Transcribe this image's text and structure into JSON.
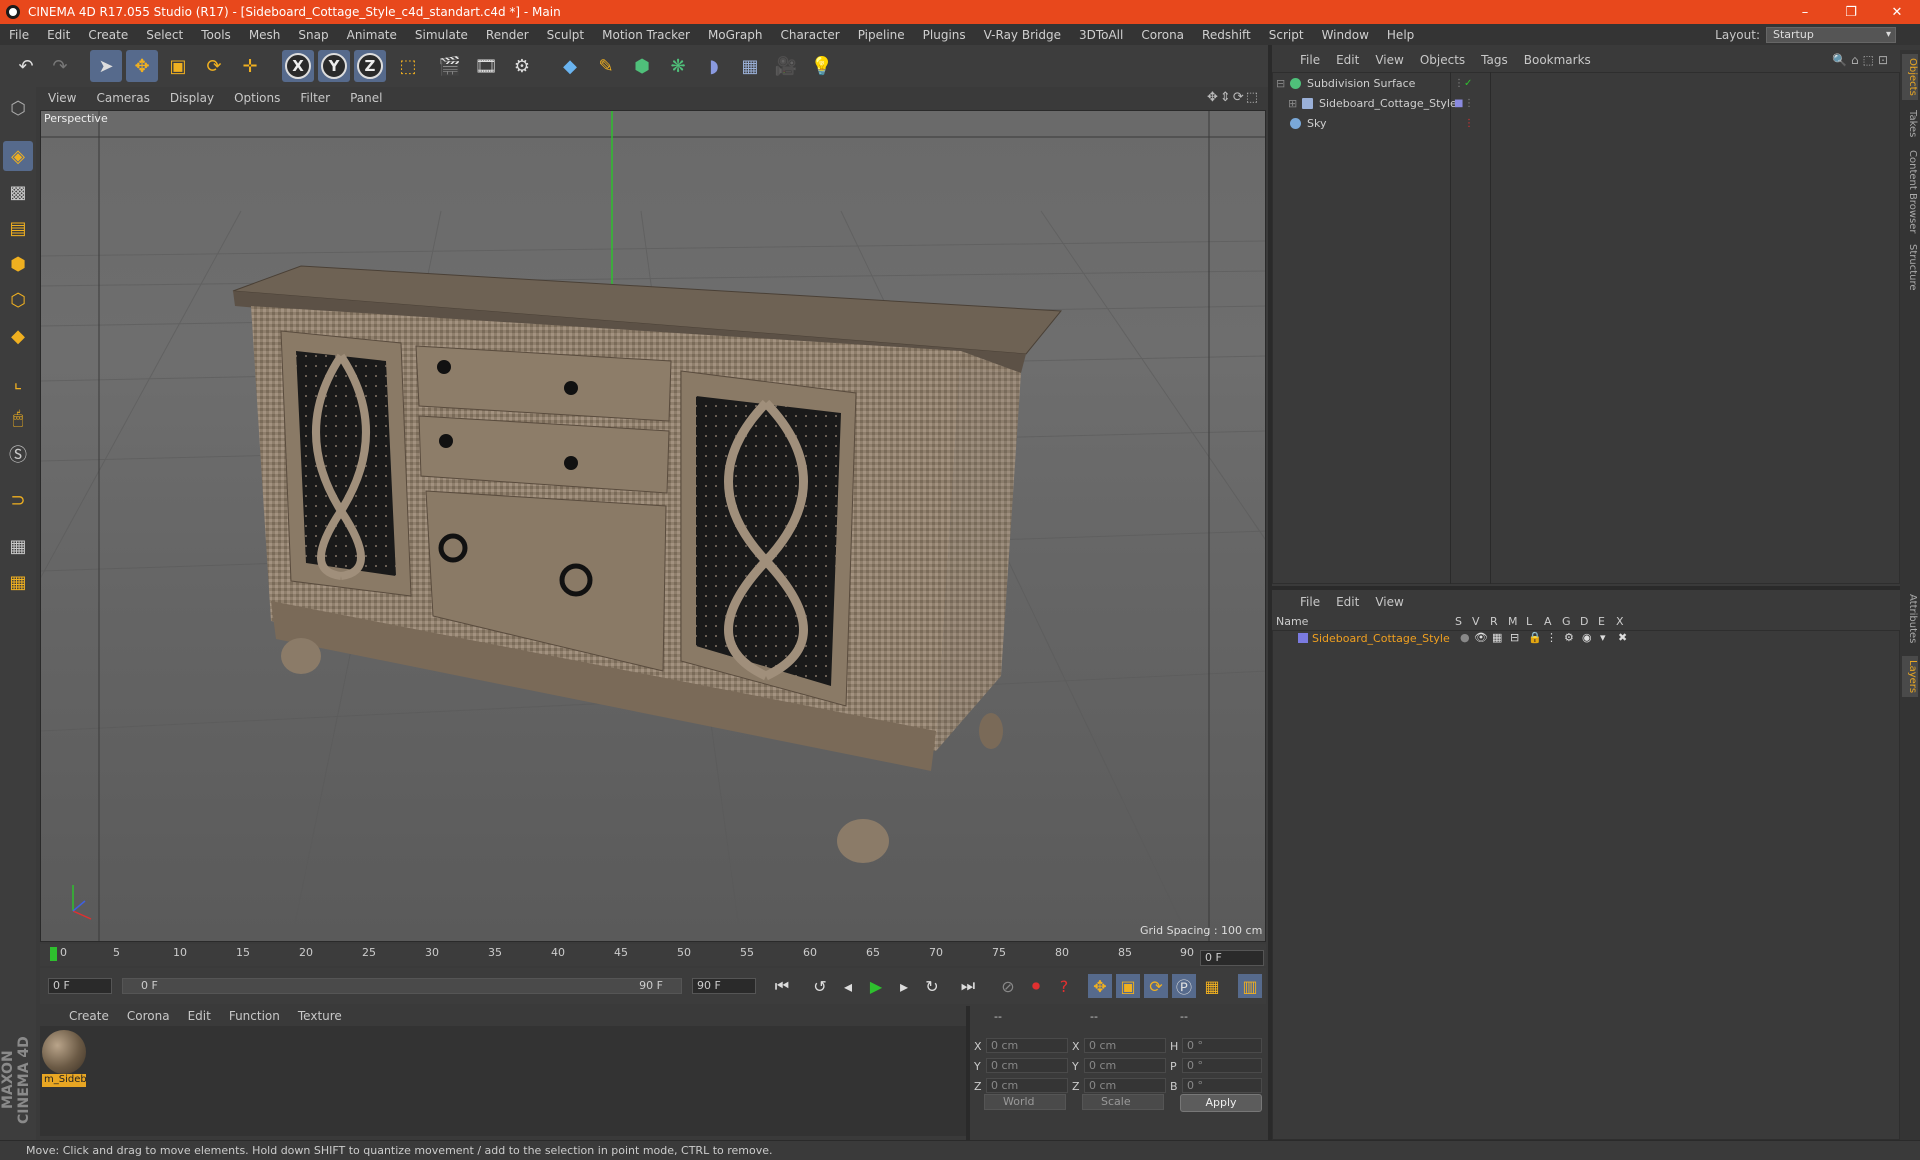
{
  "window": {
    "title": "CINEMA 4D R17.055 Studio (R17) - [Sideboard_Cottage_Style_c4d_standart.c4d *] - Main",
    "minimize": "–",
    "restore": "❐",
    "close": "✕"
  },
  "menubar": {
    "items": [
      "File",
      "Edit",
      "Create",
      "Select",
      "Tools",
      "Mesh",
      "Snap",
      "Animate",
      "Simulate",
      "Render",
      "Sculpt",
      "Motion Tracker",
      "MoGraph",
      "Character",
      "Pipeline",
      "Plugins",
      "V-Ray Bridge",
      "3DToAll",
      "Corona",
      "Redshift",
      "Script",
      "Window",
      "Help"
    ],
    "layout_label": "Layout:",
    "layout_value": "Startup"
  },
  "toolbar": {
    "axis_x": "X",
    "axis_y": "Y",
    "axis_z": "Z",
    "icons": [
      "undo-icon",
      "redo-icon",
      "select-icon",
      "move-icon",
      "scale-icon",
      "rotate-icon",
      "add-icon",
      "x-axis-icon",
      "y-axis-icon",
      "z-axis-icon",
      "coordinate-system-icon",
      "render-view-icon",
      "render-picture-viewer-icon",
      "edit-render-settings-icon",
      "cube-icon",
      "pen-icon",
      "subdivision-icon",
      "cloner-icon",
      "deformer-icon",
      "floor-icon",
      "camera-icon",
      "light-icon"
    ]
  },
  "viewport": {
    "menu": [
      "View",
      "Cameras",
      "Display",
      "Options",
      "Filter",
      "Panel"
    ],
    "label": "Perspective",
    "grid_spacing": "Grid Spacing : 100 cm"
  },
  "timeline": {
    "ticks": [
      "0",
      "5",
      "10",
      "15",
      "20",
      "25",
      "30",
      "35",
      "40",
      "45",
      "50",
      "55",
      "60",
      "65",
      "70",
      "75",
      "80",
      "85",
      "90"
    ],
    "current_frame": "0 F",
    "start_field": "0 F",
    "range_start": "0 F",
    "range_end": "90 F",
    "end_field": "90 F"
  },
  "material_manager": {
    "menu": [
      "Create",
      "Corona",
      "Edit",
      "Function",
      "Texture"
    ],
    "material_name": "m_Sideb"
  },
  "coordinates": {
    "headers": [
      "--",
      "--",
      "--"
    ],
    "rows": [
      {
        "a": "X",
        "av": "0 cm",
        "b": "X",
        "bv": "0 cm",
        "c": "H",
        "cv": "0 °"
      },
      {
        "a": "Y",
        "av": "0 cm",
        "b": "Y",
        "bv": "0 cm",
        "c": "P",
        "cv": "0 °"
      },
      {
        "a": "Z",
        "av": "0 cm",
        "b": "Z",
        "bv": "0 cm",
        "c": "B",
        "cv": "0 °"
      }
    ],
    "space": "World",
    "mode": "Scale",
    "apply": "Apply"
  },
  "status": {
    "text": "Move: Click and drag to move elements. Hold down SHIFT to quantize movement / add to the selection in point mode, CTRL to remove."
  },
  "object_manager": {
    "menu": [
      "File",
      "Edit",
      "View",
      "Objects",
      "Tags",
      "Bookmarks"
    ],
    "objects": [
      {
        "name": "Subdivision Surface",
        "icon_color": "#4fc07a"
      },
      {
        "name": "Sideboard_Cottage_Style",
        "icon_color": "#9ab0d8"
      },
      {
        "name": "Sky",
        "icon_color": "#7aa8d8"
      }
    ]
  },
  "layer_manager": {
    "menu": [
      "File",
      "Edit",
      "View"
    ],
    "columns": [
      "Name",
      "S",
      "V",
      "R",
      "M",
      "L",
      "A",
      "G",
      "D",
      "E",
      "X"
    ],
    "layers": [
      {
        "name": "Sideboard_Cottage_Style",
        "color": "#7a7ae0"
      }
    ]
  },
  "right_tabs": [
    "Objects",
    "Takes",
    "Content Browser",
    "Structure",
    "Attributes",
    "Layers"
  ],
  "branding": {
    "logo_text": "MAXON CINEMA 4D"
  }
}
